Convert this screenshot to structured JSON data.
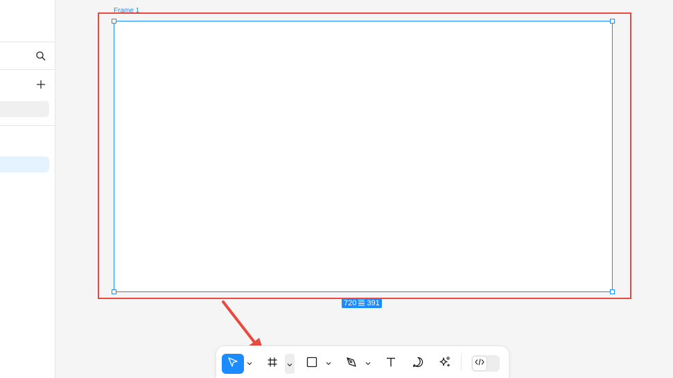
{
  "canvas": {
    "frame": {
      "name": "Frame 1",
      "width_value": "720",
      "height_value": "391"
    }
  },
  "sidebar": {
    "icons": [
      "search-icon",
      "plus-icon"
    ]
  },
  "toolbar": {
    "tools": [
      {
        "name": "move-tool",
        "icon": "cursor-icon",
        "active": true
      },
      {
        "name": "frame-tool",
        "icon": "hash-icon",
        "active": false
      },
      {
        "name": "shape-tool",
        "icon": "square-icon",
        "active": false
      },
      {
        "name": "pen-tool",
        "icon": "pen-icon",
        "active": false
      },
      {
        "name": "text-tool",
        "icon": "text-icon",
        "active": false
      },
      {
        "name": "comment-tool",
        "icon": "comment-icon",
        "active": false
      },
      {
        "name": "actions-tool",
        "icon": "sparkle-icon",
        "active": false
      }
    ],
    "dev_mode_icon": "code-icon"
  },
  "colors": {
    "accent": "#1a8cff",
    "annotation": "#e84a3f",
    "canvas_bg": "#f5f5f5"
  }
}
